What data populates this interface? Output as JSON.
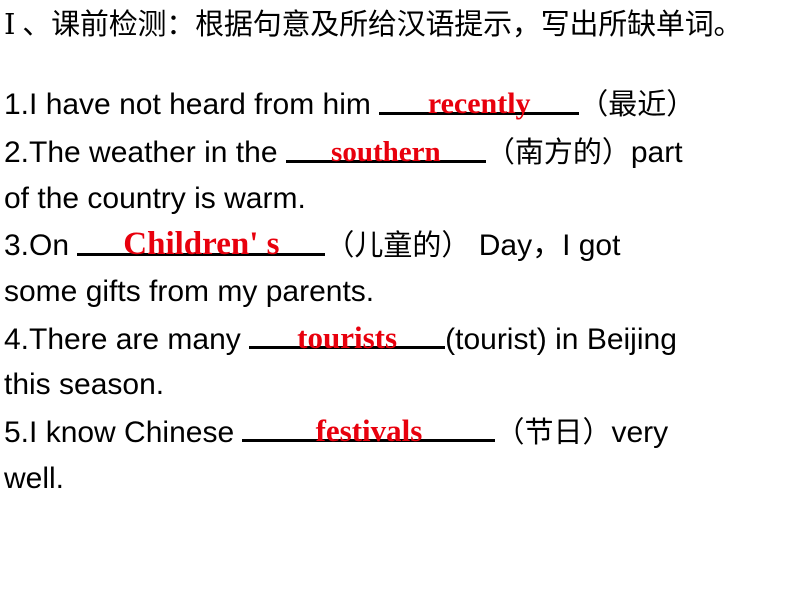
{
  "slide": {
    "background_color": "#ffffff",
    "text_color": "#000000",
    "answer_color": "#e8000d"
  },
  "heading": {
    "text": "Ⅰ 、课前检测：根据句意及所给汉语提示，写出所缺单词。"
  },
  "questions": [
    {
      "number": "1.",
      "lines": [
        {
          "segments": [
            {
              "type": "text",
              "value": "1.I have not heard from him "
            },
            {
              "type": "blank",
              "answer": "recently"
            },
            {
              "type": "cjk",
              "value": "（最近）"
            }
          ]
        }
      ]
    },
    {
      "number": "2.",
      "lines": [
        {
          "segments": [
            {
              "type": "text",
              "value": "2.The weather in the "
            },
            {
              "type": "blank",
              "answer": "southern"
            },
            {
              "type": "cjk",
              "value": "（南方的）"
            },
            {
              "type": "text",
              "value": "part"
            }
          ]
        },
        {
          "segments": [
            {
              "type": "text",
              "value": "of the country is warm."
            }
          ]
        }
      ]
    },
    {
      "number": "3.",
      "lines": [
        {
          "segments": [
            {
              "type": "text",
              "value": "3.On "
            },
            {
              "type": "blank",
              "answer": "Children' s"
            },
            {
              "type": "cjk",
              "value": "（儿童的）"
            },
            {
              "type": "text",
              "value": " Day，I got"
            }
          ]
        },
        {
          "segments": [
            {
              "type": "text",
              "value": "some gifts from my parents."
            }
          ]
        }
      ]
    },
    {
      "number": "4.",
      "lines": [
        {
          "segments": [
            {
              "type": "text",
              "value": "4.There are many "
            },
            {
              "type": "blank",
              "answer": "tourists"
            },
            {
              "type": "text",
              "value": "(tourist) in Beijing"
            }
          ]
        },
        {
          "segments": [
            {
              "type": "text",
              "value": "this season."
            }
          ]
        }
      ]
    },
    {
      "number": "5.",
      "lines": [
        {
          "segments": [
            {
              "type": "text",
              "value": "5.I know Chinese "
            },
            {
              "type": "blank",
              "answer": "festivals"
            },
            {
              "type": "cjk",
              "value": "（节日）"
            },
            {
              "type": "text",
              "value": "very"
            }
          ]
        },
        {
          "segments": [
            {
              "type": "text",
              "value": "well."
            }
          ]
        }
      ]
    }
  ],
  "q1": {
    "prefix": "1.I have not heard from him ",
    "answer": "recently",
    "hint": "（最近）"
  },
  "q2": {
    "prefix": "2.The weather in the ",
    "answer": "southern",
    "hint": "（南方的）",
    "suffix": "part",
    "line2": "of the country is warm."
  },
  "q3": {
    "prefix": "3.On ",
    "answer": "Children' s",
    "hint": "（儿童的）",
    "suffix": " Day，I got",
    "line2": "some gifts from my parents."
  },
  "q4": {
    "prefix": "4.There are many ",
    "answer": "tourists",
    "suffix": "(tourist) in Beijing",
    "line2": "this season."
  },
  "q5": {
    "prefix": "5.I know Chinese ",
    "answer": "festivals",
    "hint": "（节日）",
    "suffix": "very",
    "line2": "well."
  }
}
